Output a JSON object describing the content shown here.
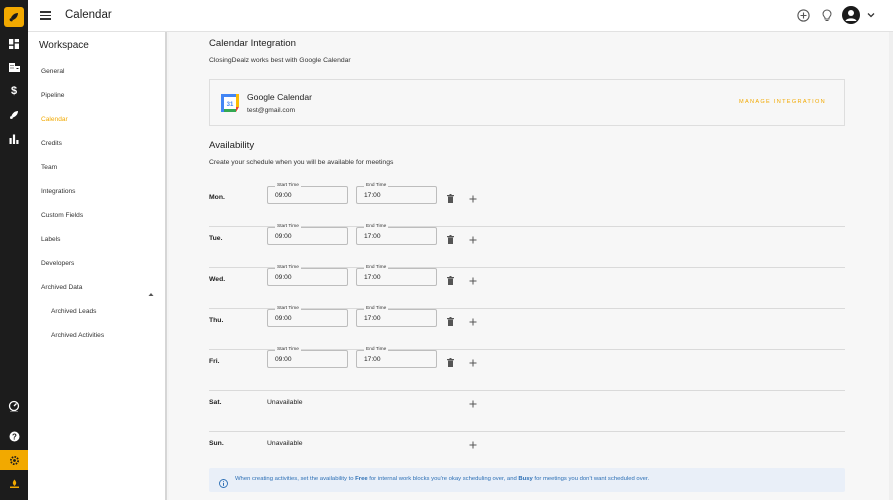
{
  "app": {
    "title": "Calendar",
    "accent_color": "#f2a900",
    "rail_icons": [
      "rocket-logo-icon",
      "dashboard-icon",
      "building-icon",
      "dollar-icon",
      "rocket-icon",
      "bar-chart-icon",
      "speedometer-icon",
      "help-icon",
      "gear-icon",
      "campfire-icon"
    ],
    "header_icons": [
      "add-circle-icon",
      "lightbulb-icon",
      "avatar",
      "chevron-down-icon"
    ]
  },
  "sidebar": {
    "heading": "Workspace",
    "items": [
      {
        "label": "General"
      },
      {
        "label": "Pipeline"
      },
      {
        "label": "Calendar"
      },
      {
        "label": "Credits"
      },
      {
        "label": "Team"
      },
      {
        "label": "Integrations"
      },
      {
        "label": "Custom Fields"
      },
      {
        "label": "Labels"
      },
      {
        "label": "Developers"
      },
      {
        "label": "Archived Data"
      },
      {
        "label": "Archived Leads"
      },
      {
        "label": "Archived Activities"
      }
    ],
    "active": "Calendar"
  },
  "integration": {
    "title": "Calendar Integration",
    "subtitle": "ClosingDealz works best with Google Calendar",
    "provider": "Google Calendar",
    "email": "test@gmail.com",
    "manage_label": "MANAGE INTEGRATION",
    "icon_day": "31"
  },
  "availability": {
    "title": "Availability",
    "subtitle": "Create your schedule when you will be available for meetings",
    "start_label": "Start Time",
    "end_label": "End Time",
    "days": [
      {
        "day": "Mon.",
        "start": "09:00",
        "end": "17:00"
      },
      {
        "day": "Tue.",
        "start": "09:00",
        "end": "17:00"
      },
      {
        "day": "Wed.",
        "start": "09:00",
        "end": "17:00"
      },
      {
        "day": "Thu.",
        "start": "09:00",
        "end": "17:00"
      },
      {
        "day": "Fri.",
        "start": "09:00",
        "end": "17:00"
      },
      {
        "day": "Sat.",
        "unavailable": "Unavailable"
      },
      {
        "day": "Sun.",
        "unavailable": "Unavailable"
      }
    ]
  },
  "info": {
    "t1": "When creating activities, set the availability to ",
    "b1": "Free",
    "t2": " for internal work blocks you're okay scheduling over, and ",
    "b2": "Busy",
    "t3": " for meetings you don't want scheduled over."
  }
}
